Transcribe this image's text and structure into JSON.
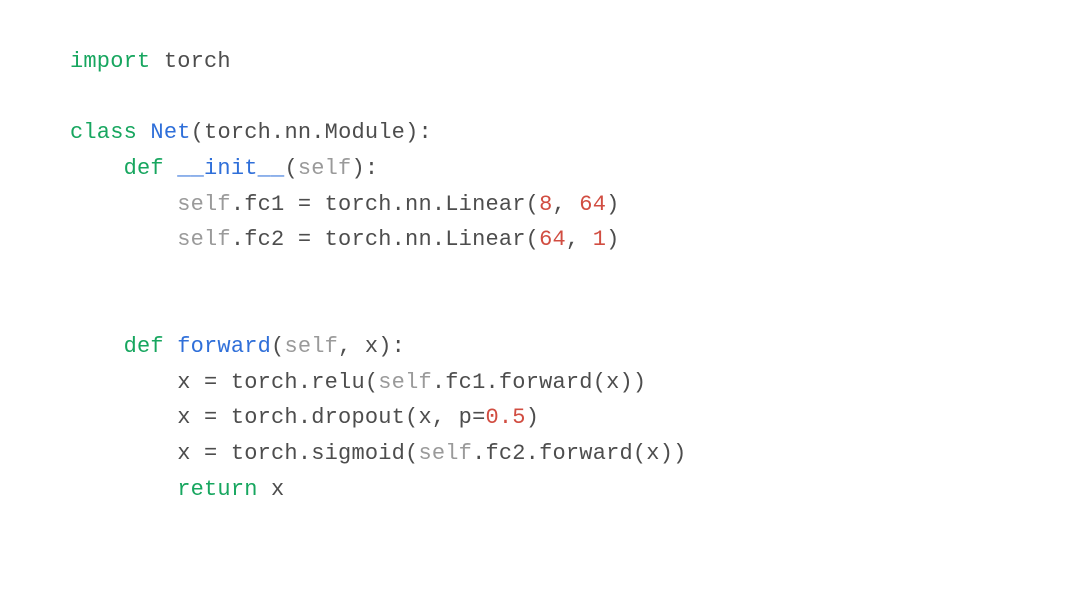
{
  "code": {
    "lines": [
      {
        "indent": 0,
        "segments": [
          {
            "t": "import ",
            "cls": "kw-green"
          },
          {
            "t": "torch",
            "cls": "txt"
          }
        ]
      },
      {
        "indent": 0,
        "segments": []
      },
      {
        "indent": 0,
        "segments": [
          {
            "t": "class ",
            "cls": "kw-green"
          },
          {
            "t": "Net",
            "cls": "fn-blue"
          },
          {
            "t": "(torch.nn.Module):",
            "cls": "txt"
          }
        ]
      },
      {
        "indent": 1,
        "segments": [
          {
            "t": "def ",
            "cls": "kw-green"
          },
          {
            "t": "__init__",
            "cls": "fn-blue"
          },
          {
            "t": "(",
            "cls": "txt"
          },
          {
            "t": "self",
            "cls": "self-gray"
          },
          {
            "t": "):",
            "cls": "txt"
          }
        ]
      },
      {
        "indent": 2,
        "segments": [
          {
            "t": "self",
            "cls": "self-gray"
          },
          {
            "t": ".fc1 = torch.nn.Linear(",
            "cls": "txt"
          },
          {
            "t": "8",
            "cls": "nm-red"
          },
          {
            "t": ", ",
            "cls": "txt"
          },
          {
            "t": "64",
            "cls": "nm-red"
          },
          {
            "t": ")",
            "cls": "txt"
          }
        ]
      },
      {
        "indent": 2,
        "segments": [
          {
            "t": "self",
            "cls": "self-gray"
          },
          {
            "t": ".fc2 = torch.nn.Linear(",
            "cls": "txt"
          },
          {
            "t": "64",
            "cls": "nm-red"
          },
          {
            "t": ", ",
            "cls": "txt"
          },
          {
            "t": "1",
            "cls": "nm-red"
          },
          {
            "t": ")",
            "cls": "txt"
          }
        ]
      },
      {
        "indent": 0,
        "segments": []
      },
      {
        "indent": 0,
        "segments": []
      },
      {
        "indent": 1,
        "segments": [
          {
            "t": "def ",
            "cls": "kw-green"
          },
          {
            "t": "forward",
            "cls": "fn-blue"
          },
          {
            "t": "(",
            "cls": "txt"
          },
          {
            "t": "self",
            "cls": "self-gray"
          },
          {
            "t": ", x):",
            "cls": "txt"
          }
        ]
      },
      {
        "indent": 2,
        "segments": [
          {
            "t": "x = torch.relu(",
            "cls": "txt"
          },
          {
            "t": "self",
            "cls": "self-gray"
          },
          {
            "t": ".fc1.forward(x))",
            "cls": "txt"
          }
        ]
      },
      {
        "indent": 2,
        "segments": [
          {
            "t": "x = torch.dropout(x, p=",
            "cls": "txt"
          },
          {
            "t": "0.5",
            "cls": "nm-red"
          },
          {
            "t": ")",
            "cls": "txt"
          }
        ]
      },
      {
        "indent": 2,
        "segments": [
          {
            "t": "x = torch.sigmoid(",
            "cls": "txt"
          },
          {
            "t": "self",
            "cls": "self-gray"
          },
          {
            "t": ".fc2.forward(x))",
            "cls": "txt"
          }
        ]
      },
      {
        "indent": 2,
        "segments": [
          {
            "t": "return ",
            "cls": "kw-green"
          },
          {
            "t": "x",
            "cls": "txt"
          }
        ]
      }
    ],
    "indent_unit": "    "
  }
}
